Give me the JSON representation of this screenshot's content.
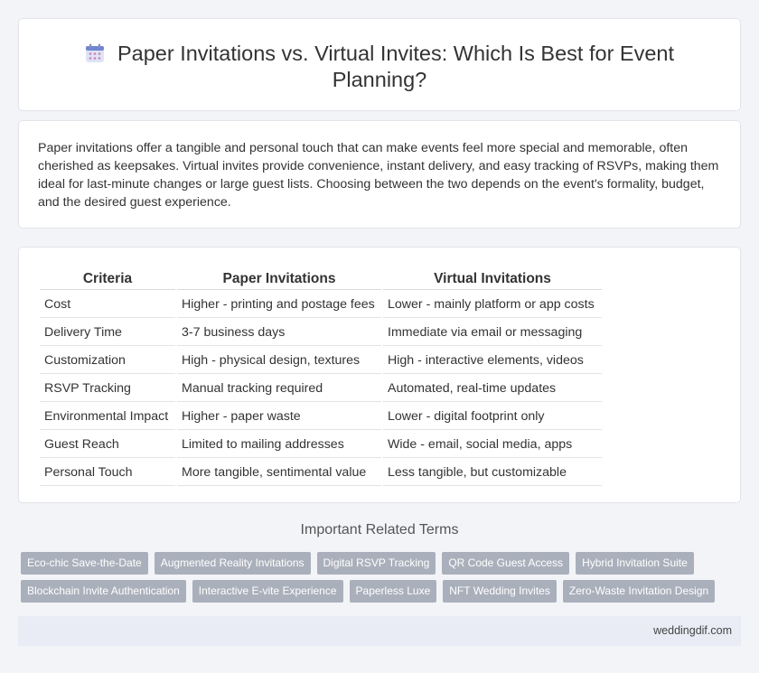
{
  "header": {
    "title": "Paper Invitations vs. Virtual Invites: Which Is Best for Event Planning?",
    "icon": "calendar-icon"
  },
  "intro": {
    "text": "Paper invitations offer a tangible and personal touch that can make events feel more special and memorable, often cherished as keepsakes. Virtual invites provide convenience, instant delivery, and easy tracking of RSVPs, making them ideal for last-minute changes or large guest lists. Choosing between the two depends on the event's formality, budget, and the desired guest experience."
  },
  "table": {
    "headers": [
      "Criteria",
      "Paper Invitations",
      "Virtual Invitations"
    ],
    "rows": [
      [
        "Cost",
        "Higher - printing and postage fees",
        "Lower - mainly platform or app costs"
      ],
      [
        "Delivery Time",
        "3-7 business days",
        "Immediate via email or messaging"
      ],
      [
        "Customization",
        "High - physical design, textures",
        "High - interactive elements, videos"
      ],
      [
        "RSVP Tracking",
        "Manual tracking required",
        "Automated, real-time updates"
      ],
      [
        "Environmental Impact",
        "Higher - paper waste",
        "Lower - digital footprint only"
      ],
      [
        "Guest Reach",
        "Limited to mailing addresses",
        "Wide - email, social media, apps"
      ],
      [
        "Personal Touch",
        "More tangible, sentimental value",
        "Less tangible, but customizable"
      ]
    ]
  },
  "related": {
    "heading": "Important Related Terms",
    "tags": [
      "Eco-chic Save-the-Date",
      "Augmented Reality Invitations",
      "Digital RSVP Tracking",
      "QR Code Guest Access",
      "Hybrid Invitation Suite",
      "Blockchain Invite Authentication",
      "Interactive E-vite Experience",
      "Paperless Luxe",
      "NFT Wedding Invites",
      "Zero-Waste Invitation Design"
    ]
  },
  "footer": {
    "site": "weddingdif.com"
  }
}
